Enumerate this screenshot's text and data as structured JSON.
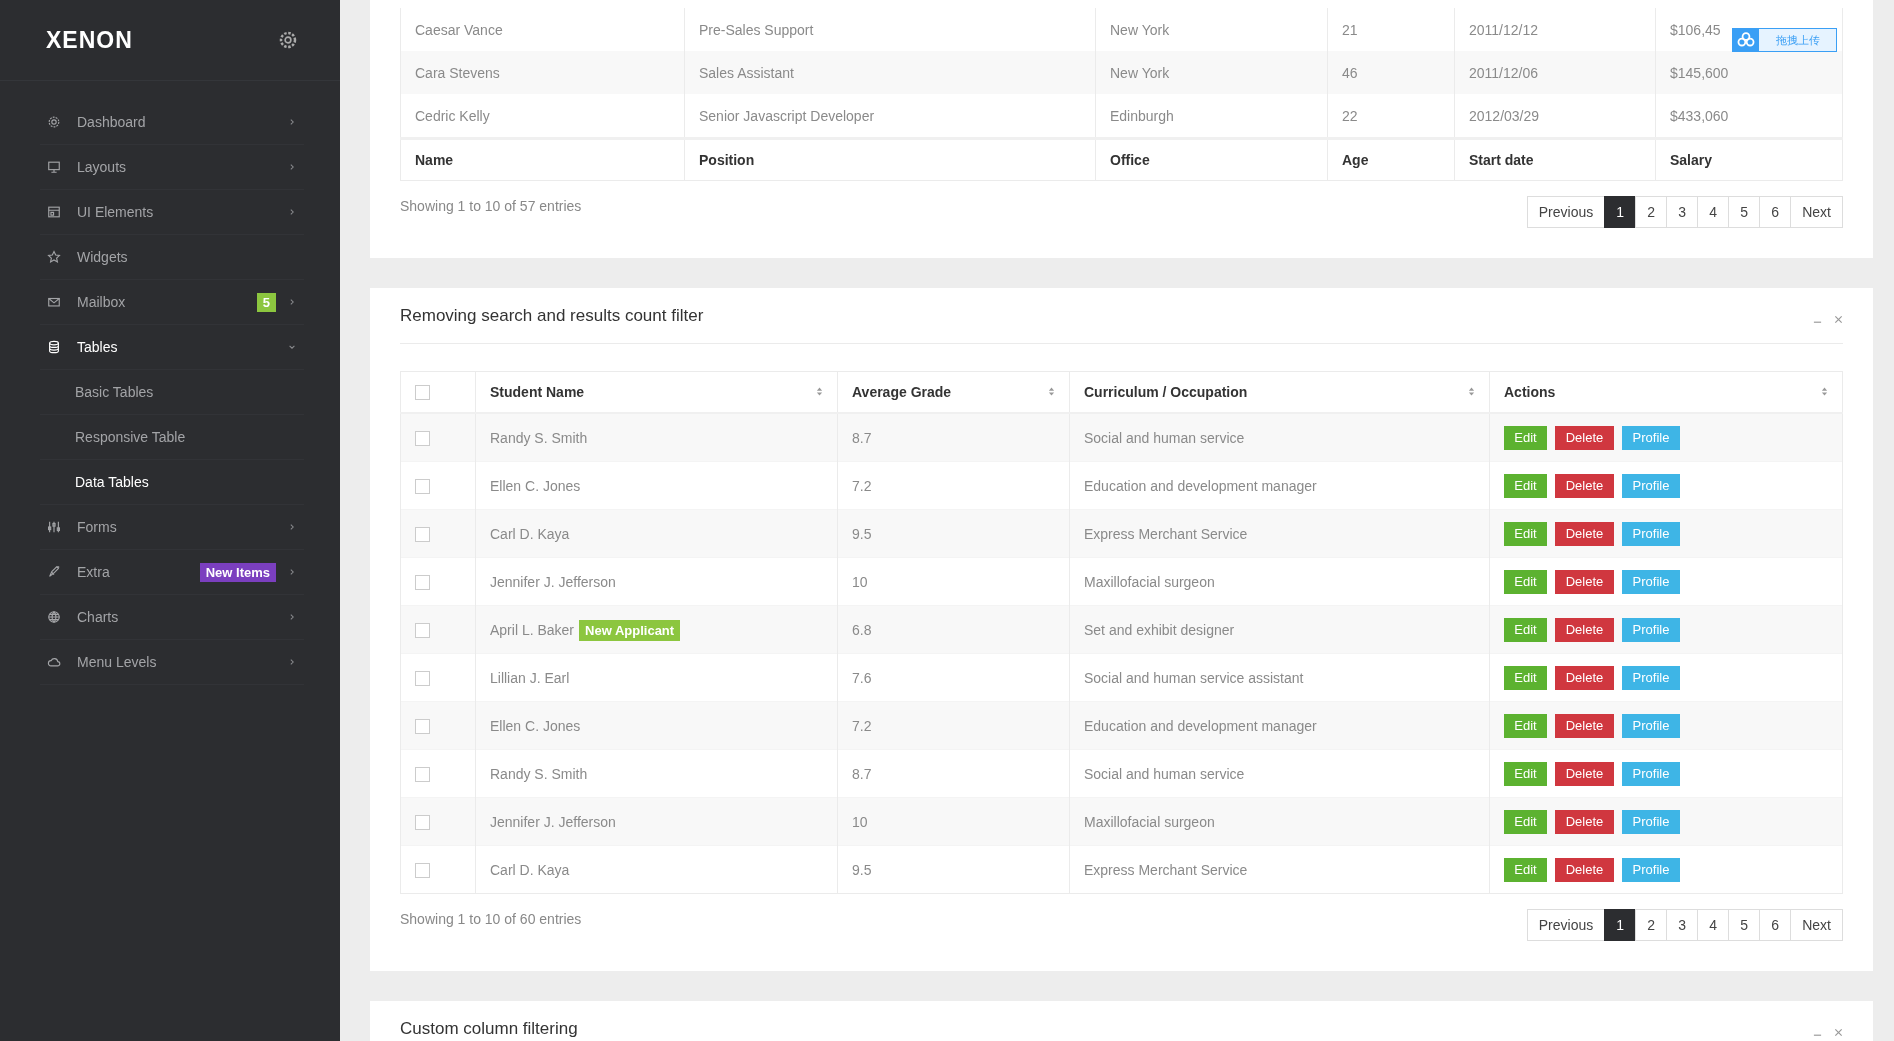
{
  "sidebar": {
    "brand": "XENON",
    "items": [
      {
        "label": "Dashboard",
        "kind": "submenu",
        "expanded": false,
        "selected": false
      },
      {
        "label": "Layouts",
        "kind": "submenu",
        "expanded": false,
        "selected": false
      },
      {
        "label": "UI Elements",
        "kind": "submenu",
        "expanded": false,
        "selected": false
      },
      {
        "label": "Widgets",
        "kind": "link",
        "selected": false
      },
      {
        "label": "Mailbox",
        "kind": "submenu",
        "expanded": false,
        "selected": false,
        "badge": {
          "text": "5",
          "color": "#8cc63f"
        }
      },
      {
        "label": "Tables",
        "kind": "submenu",
        "expanded": true,
        "selected": true,
        "children": [
          {
            "label": "Basic Tables",
            "selected": false
          },
          {
            "label": "Responsive Table",
            "selected": false
          },
          {
            "label": "Data Tables",
            "selected": true
          }
        ]
      },
      {
        "label": "Forms",
        "kind": "submenu",
        "expanded": false,
        "selected": false
      },
      {
        "label": "Extra",
        "kind": "submenu",
        "expanded": false,
        "selected": false,
        "badge": {
          "text": "New Items",
          "color": "#7b3fbf"
        }
      },
      {
        "label": "Charts",
        "kind": "submenu",
        "expanded": false,
        "selected": false
      },
      {
        "label": "Menu Levels",
        "kind": "submenu",
        "expanded": false,
        "selected": false
      }
    ]
  },
  "employees_card": {
    "rows": [
      [
        "Caesar Vance",
        "Pre-Sales Support",
        "New York",
        "21",
        "2011/12/12",
        "$106,45"
      ],
      [
        "Cara Stevens",
        "Sales Assistant",
        "New York",
        "46",
        "2011/12/06",
        "$145,600"
      ],
      [
        "Cedric Kelly",
        "Senior Javascript Developer",
        "Edinburgh",
        "22",
        "2012/03/29",
        "$433,060"
      ]
    ],
    "footer_columns": [
      "Name",
      "Position",
      "Office",
      "Age",
      "Start date",
      "Salary"
    ],
    "info": "Showing 1 to 10 of 57 entries",
    "pagination": [
      {
        "label": "Previous",
        "selected": false
      },
      {
        "label": "1",
        "selected": true
      },
      {
        "label": "2",
        "selected": false
      },
      {
        "label": "3",
        "selected": false
      },
      {
        "label": "4",
        "selected": false
      },
      {
        "label": "5",
        "selected": false
      },
      {
        "label": "6",
        "selected": false
      },
      {
        "label": "Next",
        "selected": false
      }
    ]
  },
  "upload_widget": {
    "label": "拖拽上传"
  },
  "students_card": {
    "title": "Removing search and results count filter",
    "select_all": {
      "checked": false
    },
    "columns": [
      "Student Name",
      "Average Grade",
      "Curriculum / Occupation",
      "Actions"
    ],
    "rows": [
      {
        "checked": false,
        "name": "Randy S. Smith",
        "grade": "8.7",
        "occupation": "Social and human service",
        "actions": [
          {
            "label": "Edit",
            "kind": "edit"
          },
          {
            "label": "Delete",
            "kind": "delete"
          },
          {
            "label": "Profile",
            "kind": "profile"
          }
        ]
      },
      {
        "checked": false,
        "name": "Ellen C. Jones",
        "grade": "7.2",
        "occupation": "Education and development manager",
        "actions": [
          {
            "label": "Edit",
            "kind": "edit"
          },
          {
            "label": "Delete",
            "kind": "delete"
          },
          {
            "label": "Profile",
            "kind": "profile"
          }
        ]
      },
      {
        "checked": false,
        "name": "Carl D. Kaya",
        "grade": "9.5",
        "occupation": "Express Merchant Service",
        "actions": [
          {
            "label": "Edit",
            "kind": "edit"
          },
          {
            "label": "Delete",
            "kind": "delete"
          },
          {
            "label": "Profile",
            "kind": "profile"
          }
        ]
      },
      {
        "checked": false,
        "name": "Jennifer J. Jefferson",
        "grade": "10",
        "occupation": "Maxillofacial surgeon",
        "actions": [
          {
            "label": "Edit",
            "kind": "edit"
          },
          {
            "label": "Delete",
            "kind": "delete"
          },
          {
            "label": "Profile",
            "kind": "profile"
          }
        ]
      },
      {
        "checked": false,
        "name": "April L. Baker",
        "tag": "New Applicant",
        "grade": "6.8",
        "occupation": "Set and exhibit designer",
        "actions": [
          {
            "label": "Edit",
            "kind": "edit"
          },
          {
            "label": "Delete",
            "kind": "delete"
          },
          {
            "label": "Profile",
            "kind": "profile"
          }
        ]
      },
      {
        "checked": false,
        "name": "Lillian J. Earl",
        "grade": "7.6",
        "occupation": "Social and human service assistant",
        "actions": [
          {
            "label": "Edit",
            "kind": "edit"
          },
          {
            "label": "Delete",
            "kind": "delete"
          },
          {
            "label": "Profile",
            "kind": "profile"
          }
        ]
      },
      {
        "checked": false,
        "name": "Ellen C. Jones",
        "grade": "7.2",
        "occupation": "Education and development manager",
        "actions": [
          {
            "label": "Edit",
            "kind": "edit"
          },
          {
            "label": "Delete",
            "kind": "delete"
          },
          {
            "label": "Profile",
            "kind": "profile"
          }
        ]
      },
      {
        "checked": false,
        "name": "Randy S. Smith",
        "grade": "8.7",
        "occupation": "Social and human service",
        "actions": [
          {
            "label": "Edit",
            "kind": "edit"
          },
          {
            "label": "Delete",
            "kind": "delete"
          },
          {
            "label": "Profile",
            "kind": "profile"
          }
        ]
      },
      {
        "checked": false,
        "name": "Jennifer J. Jefferson",
        "grade": "10",
        "occupation": "Maxillofacial surgeon",
        "actions": [
          {
            "label": "Edit",
            "kind": "edit"
          },
          {
            "label": "Delete",
            "kind": "delete"
          },
          {
            "label": "Profile",
            "kind": "profile"
          }
        ]
      },
      {
        "checked": false,
        "name": "Carl D. Kaya",
        "grade": "9.5",
        "occupation": "Express Merchant Service",
        "actions": [
          {
            "label": "Edit",
            "kind": "edit"
          },
          {
            "label": "Delete",
            "kind": "delete"
          },
          {
            "label": "Profile",
            "kind": "profile"
          }
        ]
      }
    ],
    "info": "Showing 1 to 10 of 60 entries",
    "pagination": [
      {
        "label": "Previous",
        "selected": false
      },
      {
        "label": "1",
        "selected": true
      },
      {
        "label": "2",
        "selected": false
      },
      {
        "label": "3",
        "selected": false
      },
      {
        "label": "4",
        "selected": false
      },
      {
        "label": "5",
        "selected": false
      },
      {
        "label": "6",
        "selected": false
      },
      {
        "label": "Next",
        "selected": false
      }
    ]
  },
  "filter_card": {
    "title": "Custom column filtering"
  }
}
